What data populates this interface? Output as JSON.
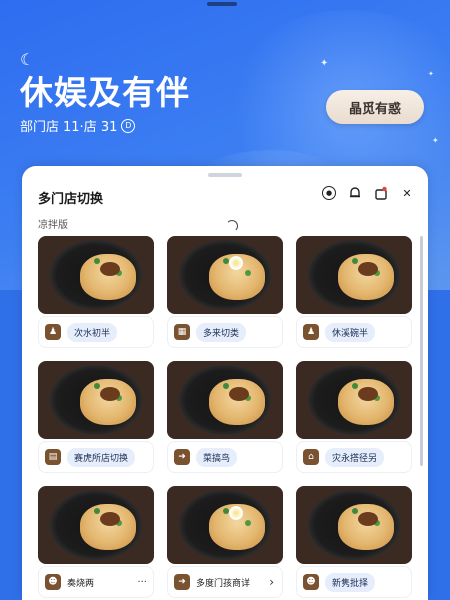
{
  "header": {
    "title": "休娱及有伴",
    "subtitle_store": "部门店",
    "subtitle_info": "11·店 31",
    "subtitle_badge": "D",
    "action_label": "晶觅有惑"
  },
  "panel": {
    "title": "多门店切换",
    "section_label": "凉拌版",
    "tools": [
      "clock-icon",
      "bell-icon",
      "bag-icon",
      "close-icon"
    ]
  },
  "stores": [
    {
      "label": "次水初半",
      "icon": "person-icon",
      "topping": "plain"
    },
    {
      "label": "多来切类",
      "icon": "chart-icon",
      "topping": "flower"
    },
    {
      "label": "休溪碗半",
      "icon": "person-icon",
      "topping": "plain"
    },
    {
      "label": "赛虎所店切换",
      "icon": "book-icon",
      "topping": "plain"
    },
    {
      "label": "菜搞鸟",
      "icon": "arrow-icon",
      "topping": "plain"
    },
    {
      "label": "灾永搭径另",
      "icon": "store-icon",
      "topping": "plain"
    },
    {
      "label": "奏烧两",
      "icon": "face-icon",
      "topping": "plain",
      "extra": "···"
    },
    {
      "label": "多度门孩商详",
      "icon": "arrow-icon",
      "topping": "flower",
      "extra": "›"
    },
    {
      "label": "新隽批择",
      "icon": "face-icon",
      "topping": "plain"
    }
  ]
}
